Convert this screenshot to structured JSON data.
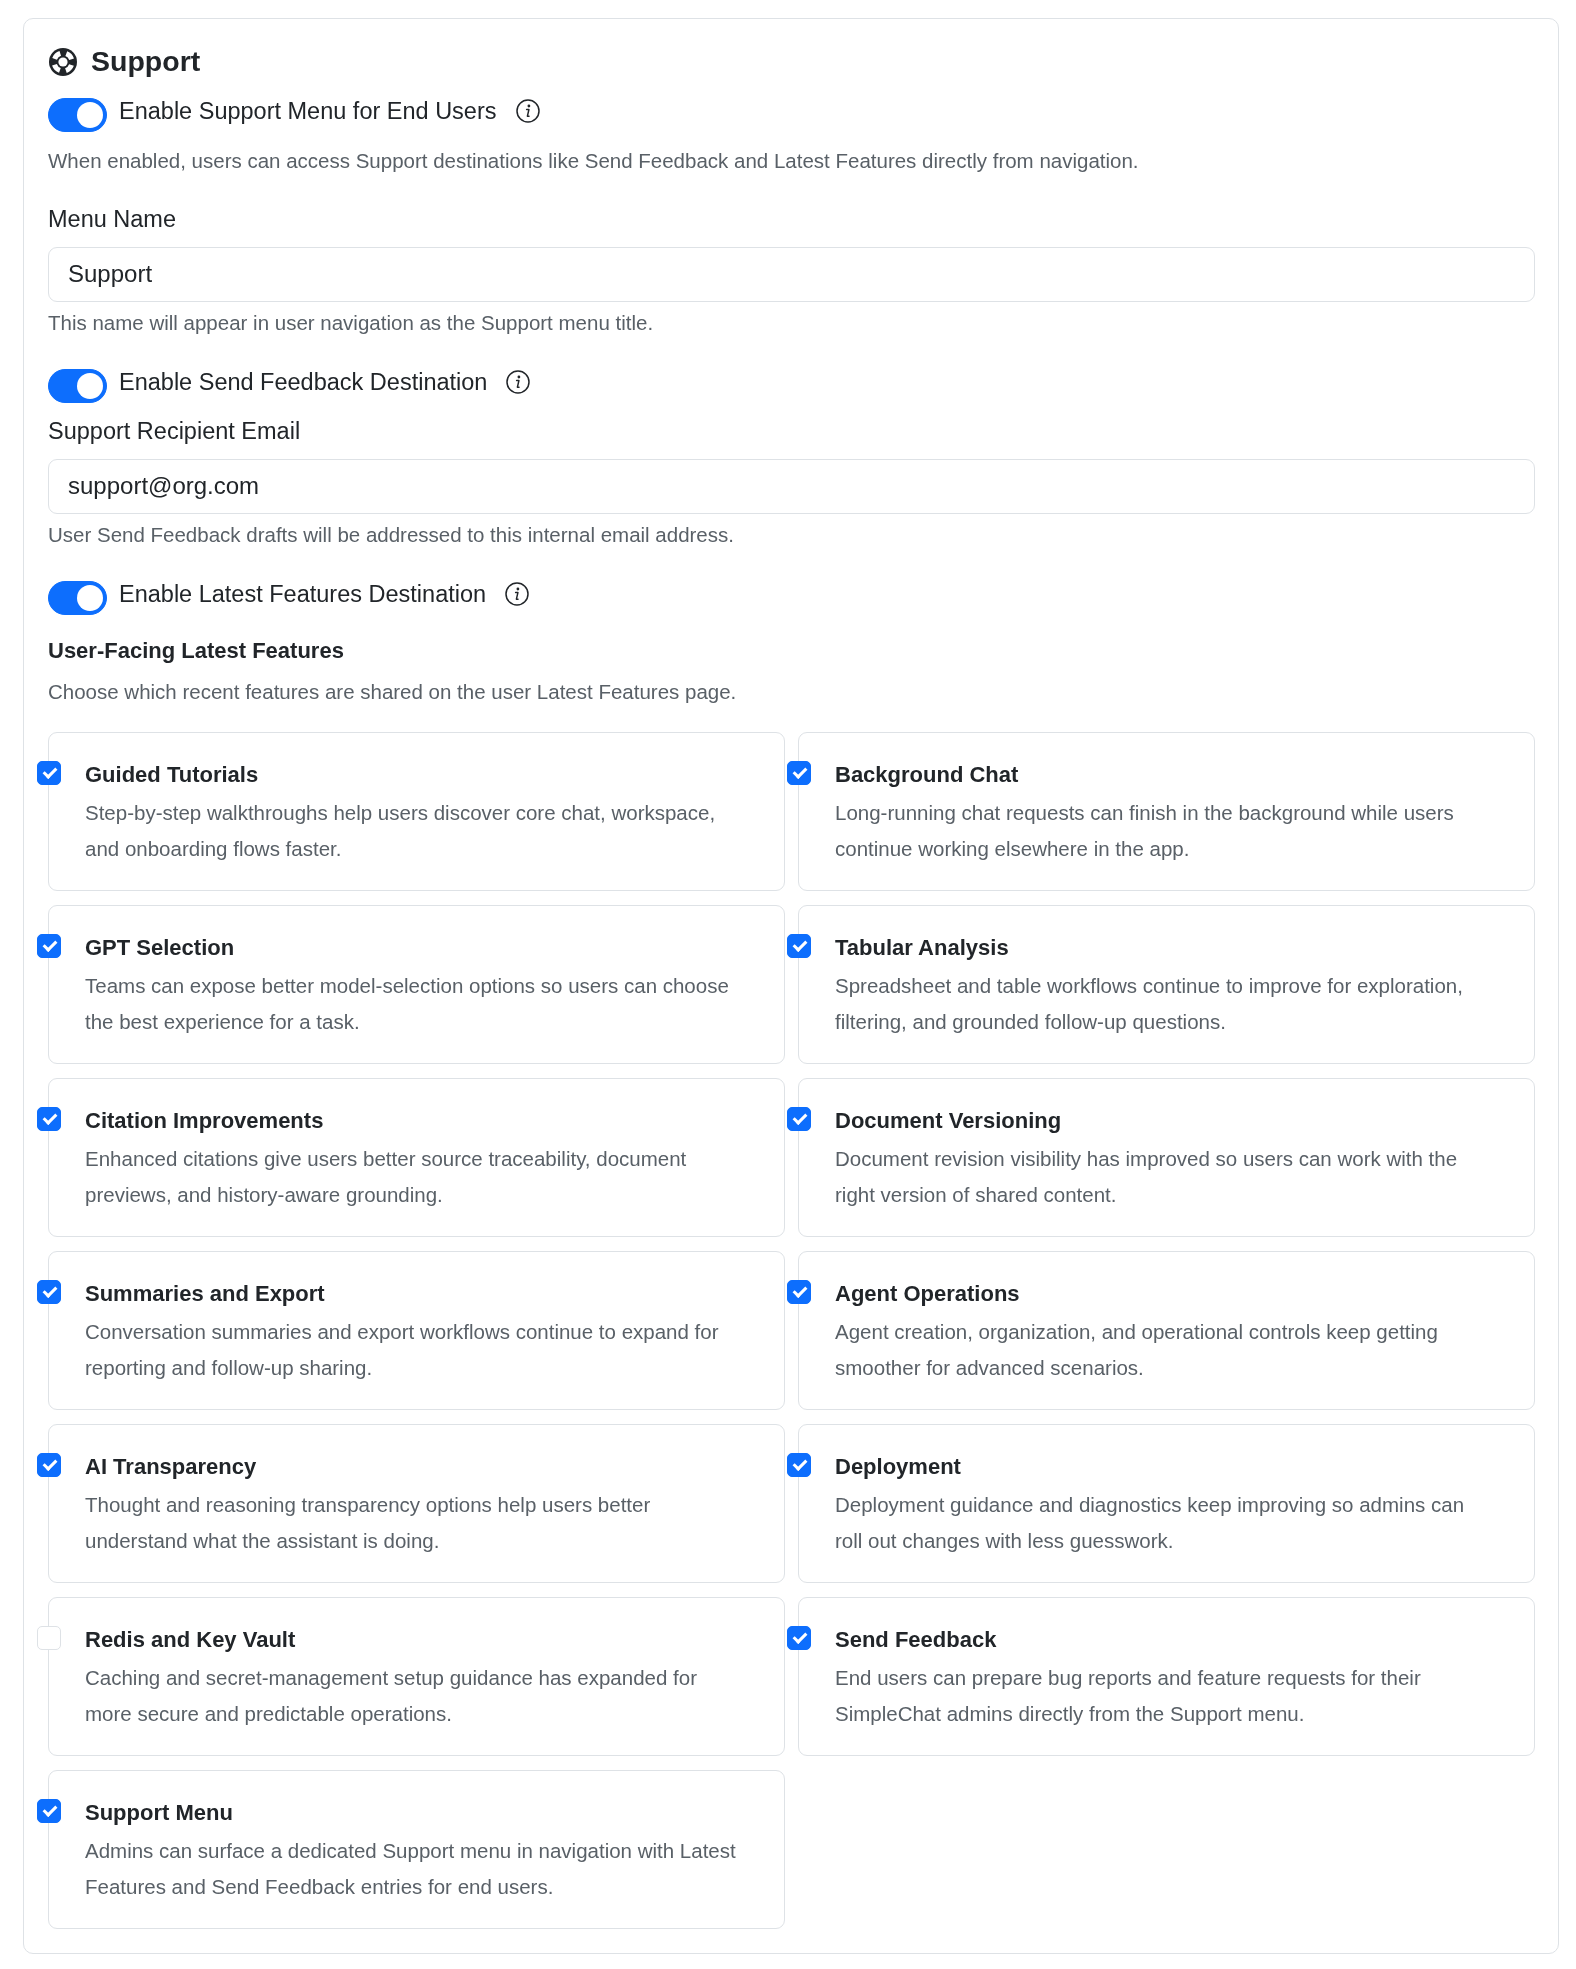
{
  "title": "Support",
  "sections": [
    {
      "kind": "toggle",
      "label": "Enable Support Menu for End Users",
      "on": true
    },
    {
      "kind": "note",
      "text": "When enabled, users can access Support destinations like Send Feedback and Latest Features directly from navigation."
    },
    {
      "kind": "field",
      "label": "Menu Name",
      "value": "Support",
      "help": "This name will appear in user navigation as the Support menu title."
    },
    {
      "kind": "toggle",
      "label": "Enable Send Feedback Destination",
      "on": true
    },
    {
      "kind": "field",
      "label": "Support Recipient Email",
      "value": "support@org.com",
      "help": "User Send Feedback drafts will be addressed to this internal email address."
    },
    {
      "kind": "toggle",
      "label": "Enable Latest Features Destination",
      "on": true
    },
    {
      "kind": "features",
      "title": "User-Facing Latest Features",
      "description": "Choose which recent features are shared on the user Latest Features page.",
      "items": [
        {
          "title": "Guided Tutorials",
          "description": "Step-by-step walkthroughs help users discover core chat, workspace, and onboarding flows faster.",
          "checked": true
        },
        {
          "title": "Background Chat",
          "description": "Long-running chat requests can finish in the background while users continue working elsewhere in the app.",
          "checked": true
        },
        {
          "title": "GPT Selection",
          "description": "Teams can expose better model-selection options so users can choose the best experience for a task.",
          "checked": true
        },
        {
          "title": "Tabular Analysis",
          "description": "Spreadsheet and table workflows continue to improve for exploration, filtering, and grounded follow-up questions.",
          "checked": true
        },
        {
          "title": "Citation Improvements",
          "description": "Enhanced citations give users better source traceability, document previews, and history-aware grounding.",
          "checked": true
        },
        {
          "title": "Document Versioning",
          "description": "Document revision visibility has improved so users can work with the right version of shared content.",
          "checked": true
        },
        {
          "title": "Summaries and Export",
          "description": "Conversation summaries and export workflows continue to expand for reporting and follow-up sharing.",
          "checked": true
        },
        {
          "title": "Agent Operations",
          "description": "Agent creation, organization, and operational controls keep getting smoother for advanced scenarios.",
          "checked": true
        },
        {
          "title": "AI Transparency",
          "description": "Thought and reasoning transparency options help users better understand what the assistant is doing.",
          "checked": true
        },
        {
          "title": "Deployment",
          "description": "Deployment guidance and diagnostics keep improving so admins can roll out changes with less guesswork.",
          "checked": true
        },
        {
          "title": "Redis and Key Vault",
          "description": "Caching and secret-management setup guidance has expanded for more secure and predictable operations.",
          "checked": false
        },
        {
          "title": "Send Feedback",
          "description": "End users can prepare bug reports and feature requests for their SimpleChat admins directly from the Support menu.",
          "checked": true
        },
        {
          "title": "Support Menu",
          "description": "Admins can surface a dedicated Support menu in navigation with Latest Features and Send Feedback entries for end users.",
          "checked": true
        }
      ]
    }
  ]
}
